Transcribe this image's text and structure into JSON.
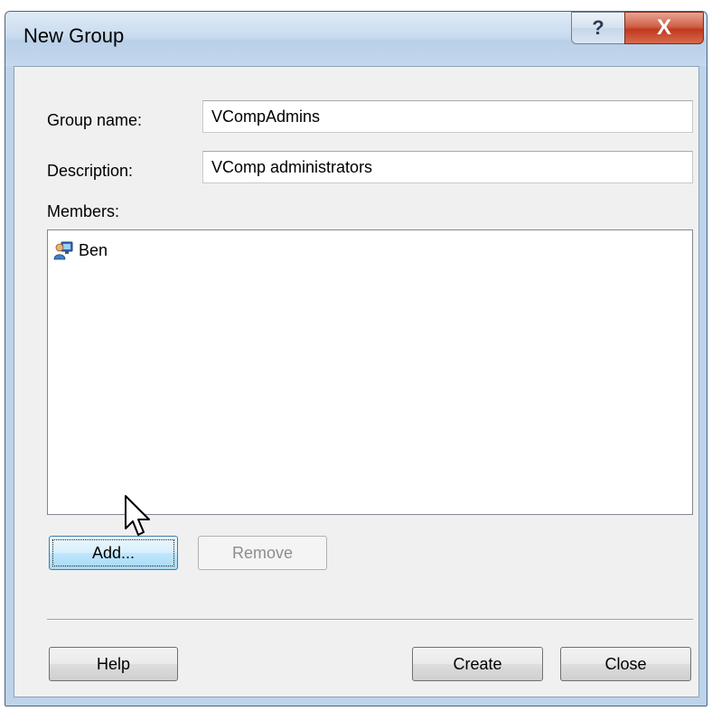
{
  "window": {
    "title": "New Group",
    "help_glyph": "?",
    "close_glyph": "X"
  },
  "form": {
    "group_name_label": "Group name:",
    "group_name_value": "VCompAdmins",
    "description_label": "Description:",
    "description_value": "VComp administrators",
    "members_label": "Members:"
  },
  "members": [
    {
      "name": "Ben",
      "icon": "user-group-icon"
    }
  ],
  "buttons": {
    "add": "Add...",
    "remove": "Remove",
    "help": "Help",
    "create": "Create",
    "close": "Close"
  },
  "colors": {
    "title_bar": "#c9dcef",
    "close_button": "#c0391f",
    "focus_button": "#bee6fd"
  }
}
